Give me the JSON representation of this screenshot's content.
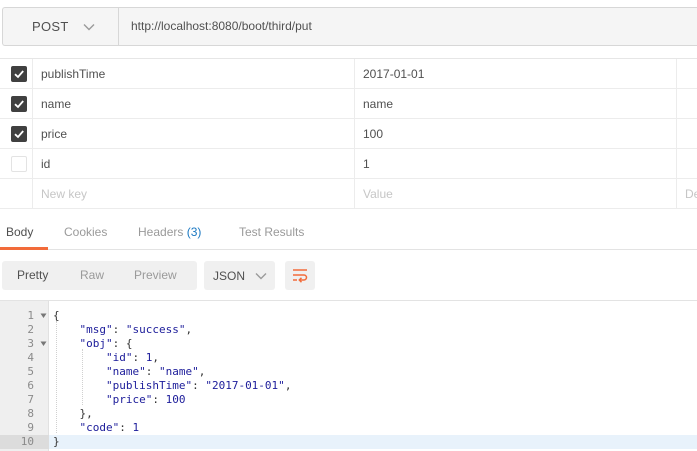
{
  "request": {
    "method": "POST",
    "url": "http://localhost:8080/boot/third/put"
  },
  "params": {
    "rows": [
      {
        "checked": true,
        "key": "publishTime",
        "value": "2017-01-01"
      },
      {
        "checked": true,
        "key": "name",
        "value": "name"
      },
      {
        "checked": true,
        "key": "price",
        "value": "100"
      },
      {
        "checked": false,
        "key": "id",
        "value": "1"
      }
    ],
    "new_key_placeholder": "New key",
    "value_placeholder": "Value",
    "description_placeholder": "De"
  },
  "response_tabs": {
    "body": "Body",
    "cookies": "Cookies",
    "headers": "Headers",
    "headers_count": "(3)",
    "test_results": "Test Results"
  },
  "view": {
    "pretty": "Pretty",
    "raw": "Raw",
    "preview": "Preview",
    "format": "JSON"
  },
  "code": {
    "line_numbers": [
      "1",
      "2",
      "3",
      "4",
      "5",
      "6",
      "7",
      "8",
      "9",
      "10"
    ],
    "lines": [
      {
        "indent": 0,
        "tokens": [
          [
            "p",
            "{"
          ]
        ]
      },
      {
        "indent": 1,
        "tokens": [
          [
            "k",
            "\"msg\""
          ],
          [
            "p",
            ": "
          ],
          [
            "s",
            "\"success\""
          ],
          [
            "p",
            ","
          ]
        ]
      },
      {
        "indent": 1,
        "tokens": [
          [
            "k",
            "\"obj\""
          ],
          [
            "p",
            ": {"
          ]
        ]
      },
      {
        "indent": 2,
        "tokens": [
          [
            "k",
            "\"id\""
          ],
          [
            "p",
            ": "
          ],
          [
            "n",
            "1"
          ],
          [
            "p",
            ","
          ]
        ]
      },
      {
        "indent": 2,
        "tokens": [
          [
            "k",
            "\"name\""
          ],
          [
            "p",
            ": "
          ],
          [
            "s",
            "\"name\""
          ],
          [
            "p",
            ","
          ]
        ]
      },
      {
        "indent": 2,
        "tokens": [
          [
            "k",
            "\"publishTime\""
          ],
          [
            "p",
            ": "
          ],
          [
            "s",
            "\"2017-01-01\""
          ],
          [
            "p",
            ","
          ]
        ]
      },
      {
        "indent": 2,
        "tokens": [
          [
            "k",
            "\"price\""
          ],
          [
            "p",
            ": "
          ],
          [
            "n",
            "100"
          ]
        ]
      },
      {
        "indent": 1,
        "tokens": [
          [
            "p",
            "},"
          ]
        ]
      },
      {
        "indent": 1,
        "tokens": [
          [
            "k",
            "\"code\""
          ],
          [
            "p",
            ": "
          ],
          [
            "n",
            "1"
          ]
        ]
      },
      {
        "indent": 0,
        "tokens": [
          [
            "p",
            "}"
          ]
        ]
      }
    ],
    "foldable_lines": [
      "1",
      "3"
    ],
    "highlighted_line": "10"
  },
  "colors": {
    "accent_tab_underline": "#f26b3a",
    "wrap_icon": "#f26b3a",
    "headers_count": "#1a78c2",
    "json_token": "#1c1c9a"
  },
  "icons": {
    "method_dropdown": "chevron-down-icon",
    "checkbox_checked": "check-icon",
    "format_dropdown": "chevron-down-icon",
    "wrap": "wrap-lines-icon",
    "fold": "fold-arrow-icon"
  }
}
